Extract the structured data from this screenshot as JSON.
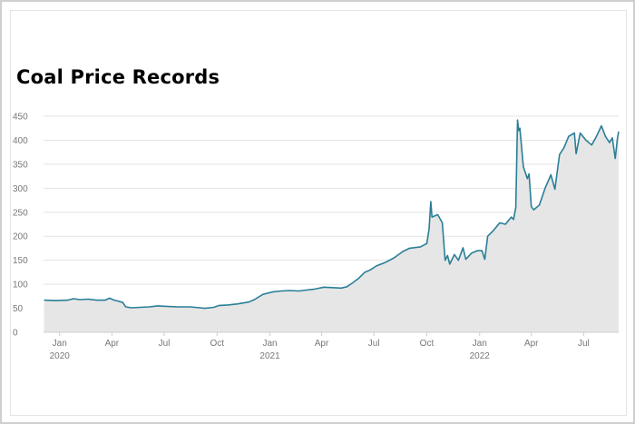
{
  "chart_data": {
    "type": "area",
    "title": "Coal Price Records",
    "xlabel": "",
    "ylabel": "",
    "ylim": [
      0,
      450
    ],
    "yticks": [
      0,
      50,
      100,
      150,
      200,
      250,
      300,
      350,
      400,
      450
    ],
    "xlim": [
      "2019-12-04",
      "2022-08-31"
    ],
    "xticks": [
      {
        "date": "2020-01-01",
        "label": "Jan",
        "year": "2020"
      },
      {
        "date": "2020-04-01",
        "label": "Apr",
        "year": ""
      },
      {
        "date": "2020-07-01",
        "label": "Jul",
        "year": ""
      },
      {
        "date": "2020-10-01",
        "label": "Oct",
        "year": ""
      },
      {
        "date": "2021-01-01",
        "label": "Jan",
        "year": "2021"
      },
      {
        "date": "2021-04-01",
        "label": "Apr",
        "year": ""
      },
      {
        "date": "2021-07-01",
        "label": "Jul",
        "year": ""
      },
      {
        "date": "2021-10-01",
        "label": "Oct",
        "year": ""
      },
      {
        "date": "2022-01-01",
        "label": "Jan",
        "year": "2022"
      },
      {
        "date": "2022-04-01",
        "label": "Apr",
        "year": ""
      },
      {
        "date": "2022-07-01",
        "label": "Jul",
        "year": ""
      }
    ],
    "grid": true,
    "line_color": "#2a7f97",
    "fill_color": "#e6e6e6",
    "series": [
      {
        "points": [
          [
            "2019-12-05",
            67
          ],
          [
            "2019-12-25",
            66
          ],
          [
            "2020-01-15",
            67
          ],
          [
            "2020-01-25",
            70
          ],
          [
            "2020-02-05",
            68
          ],
          [
            "2020-02-20",
            69
          ],
          [
            "2020-03-05",
            67
          ],
          [
            "2020-03-20",
            67
          ],
          [
            "2020-03-28",
            71
          ],
          [
            "2020-04-05",
            67
          ],
          [
            "2020-04-12",
            65
          ],
          [
            "2020-04-20",
            62
          ],
          [
            "2020-04-25",
            53
          ],
          [
            "2020-05-05",
            51
          ],
          [
            "2020-05-20",
            52
          ],
          [
            "2020-06-05",
            53
          ],
          [
            "2020-06-20",
            55
          ],
          [
            "2020-07-05",
            54
          ],
          [
            "2020-07-25",
            53
          ],
          [
            "2020-08-15",
            53
          ],
          [
            "2020-09-01",
            51
          ],
          [
            "2020-09-10",
            50
          ],
          [
            "2020-09-25",
            52
          ],
          [
            "2020-10-05",
            56
          ],
          [
            "2020-10-20",
            57
          ],
          [
            "2020-11-05",
            59
          ],
          [
            "2020-11-25",
            63
          ],
          [
            "2020-12-05",
            68
          ],
          [
            "2020-12-20",
            79
          ],
          [
            "2021-01-05",
            84
          ],
          [
            "2021-01-20",
            86
          ],
          [
            "2021-02-05",
            87
          ],
          [
            "2021-02-20",
            86
          ],
          [
            "2021-03-05",
            88
          ],
          [
            "2021-03-20",
            90
          ],
          [
            "2021-04-05",
            94
          ],
          [
            "2021-04-20",
            93
          ],
          [
            "2021-05-05",
            92
          ],
          [
            "2021-05-15",
            95
          ],
          [
            "2021-05-25",
            103
          ],
          [
            "2021-06-05",
            113
          ],
          [
            "2021-06-15",
            125
          ],
          [
            "2021-06-25",
            130
          ],
          [
            "2021-07-05",
            138
          ],
          [
            "2021-07-20",
            145
          ],
          [
            "2021-08-05",
            155
          ],
          [
            "2021-08-20",
            168
          ],
          [
            "2021-09-01",
            175
          ],
          [
            "2021-09-20",
            178
          ],
          [
            "2021-10-01",
            185
          ],
          [
            "2021-10-05",
            215
          ],
          [
            "2021-10-08",
            272
          ],
          [
            "2021-10-10",
            240
          ],
          [
            "2021-10-20",
            245
          ],
          [
            "2021-10-28",
            228
          ],
          [
            "2021-11-02",
            150
          ],
          [
            "2021-11-06",
            160
          ],
          [
            "2021-11-10",
            142
          ],
          [
            "2021-11-18",
            162
          ],
          [
            "2021-11-25",
            150
          ],
          [
            "2021-12-03",
            176
          ],
          [
            "2021-12-08",
            152
          ],
          [
            "2021-12-18",
            165
          ],
          [
            "2021-12-28",
            170
          ],
          [
            "2022-01-05",
            170
          ],
          [
            "2022-01-10",
            152
          ],
          [
            "2022-01-15",
            200
          ],
          [
            "2022-01-25",
            212
          ],
          [
            "2022-02-05",
            228
          ],
          [
            "2022-02-15",
            225
          ],
          [
            "2022-02-25",
            240
          ],
          [
            "2022-03-01",
            235
          ],
          [
            "2022-03-05",
            260
          ],
          [
            "2022-03-08",
            442
          ],
          [
            "2022-03-10",
            420
          ],
          [
            "2022-03-12",
            425
          ],
          [
            "2022-03-18",
            345
          ],
          [
            "2022-03-25",
            320
          ],
          [
            "2022-03-28",
            330
          ],
          [
            "2022-04-01",
            262
          ],
          [
            "2022-04-05",
            255
          ],
          [
            "2022-04-15",
            265
          ],
          [
            "2022-04-25",
            300
          ],
          [
            "2022-05-05",
            328
          ],
          [
            "2022-05-12",
            298
          ],
          [
            "2022-05-20",
            370
          ],
          [
            "2022-05-28",
            385
          ],
          [
            "2022-06-05",
            408
          ],
          [
            "2022-06-15",
            415
          ],
          [
            "2022-06-18",
            372
          ],
          [
            "2022-06-25",
            415
          ],
          [
            "2022-07-05",
            400
          ],
          [
            "2022-07-15",
            390
          ],
          [
            "2022-07-22",
            405
          ],
          [
            "2022-08-01",
            430
          ],
          [
            "2022-08-08",
            408
          ],
          [
            "2022-08-15",
            395
          ],
          [
            "2022-08-20",
            405
          ],
          [
            "2022-08-25",
            362
          ],
          [
            "2022-08-29",
            405
          ],
          [
            "2022-08-31",
            418
          ]
        ]
      }
    ]
  }
}
